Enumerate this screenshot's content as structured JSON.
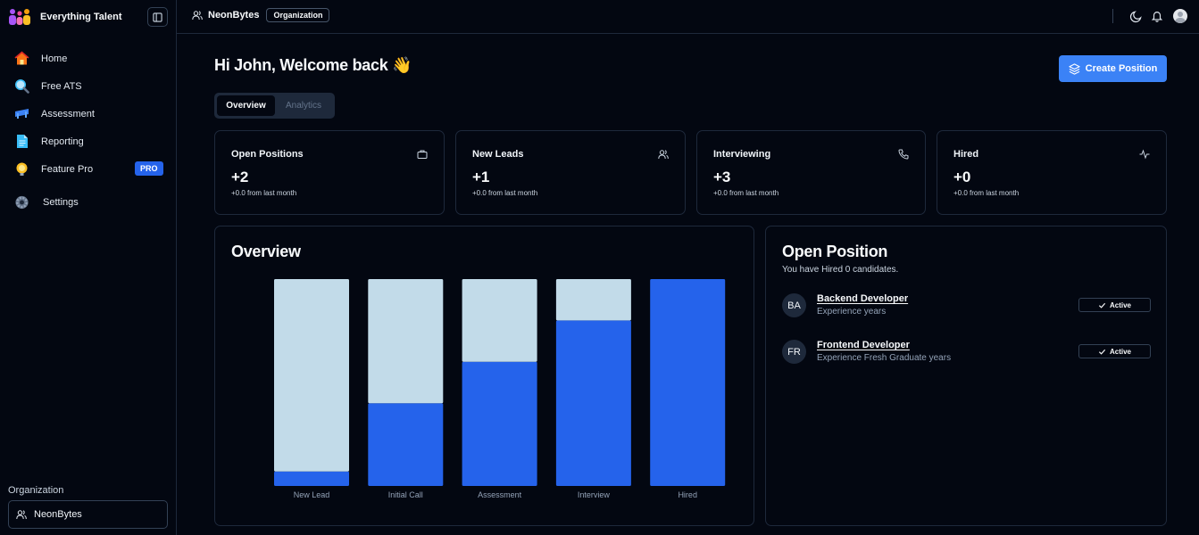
{
  "app": {
    "name": "Everything Talent"
  },
  "sidebar": {
    "items": [
      {
        "label": "Home",
        "icon": "home-icon"
      },
      {
        "label": "Free ATS",
        "icon": "magnifier-icon"
      },
      {
        "label": "Assessment",
        "icon": "assessment-icon"
      },
      {
        "label": "Reporting",
        "icon": "document-icon"
      },
      {
        "label": "Feature Pro",
        "icon": "lightbulb-icon",
        "badge": "PRO"
      },
      {
        "label": "Settings",
        "icon": "gear-icon"
      }
    ],
    "org_label": "Organization",
    "org_value": "NeonBytes"
  },
  "topbar": {
    "org_name": "NeonBytes",
    "org_badge": "Organization"
  },
  "main": {
    "greeting": "Hi John, Welcome back 👋",
    "create_label": "Create Position",
    "tabs": [
      {
        "label": "Overview",
        "active": true
      },
      {
        "label": "Analytics",
        "active": false
      }
    ]
  },
  "stats": [
    {
      "title": "Open Positions",
      "value": "+2",
      "sub": "+0.0 from last month",
      "icon": "briefcase-icon"
    },
    {
      "title": "New Leads",
      "value": "+1",
      "sub": "+0.0 from last month",
      "icon": "users-icon"
    },
    {
      "title": "Interviewing",
      "value": "+3",
      "sub": "+0.0 from last month",
      "icon": "phone-icon"
    },
    {
      "title": "Hired",
      "value": "+0",
      "sub": "+0.0 from last month",
      "icon": "activity-icon"
    }
  ],
  "overview": {
    "title": "Overview"
  },
  "chart_data": {
    "type": "bar",
    "stacked": true,
    "categories": [
      "New Lead",
      "Initial Call",
      "Assessment",
      "Interview",
      "Hired"
    ],
    "series": [
      {
        "color": "#2563eb",
        "values": [
          0.07,
          0.4,
          0.6,
          0.8,
          1.0
        ]
      },
      {
        "color": "#c2dbe9",
        "values": [
          0.93,
          0.6,
          0.4,
          0.2,
          0.0
        ]
      }
    ],
    "ylim": [
      0,
      1
    ],
    "grid": false
  },
  "open_position": {
    "title": "Open Position",
    "subtitle": "You have Hired 0 candidates.",
    "items": [
      {
        "initials": "BA",
        "name": "Backend Developer",
        "exp": "Experience years",
        "status": "Active"
      },
      {
        "initials": "FR",
        "name": "Frontend Developer",
        "exp": "Experience Fresh Graduate years",
        "status": "Active"
      }
    ]
  },
  "colors": {
    "accent": "#3b82f6",
    "bar_primary": "#2563eb",
    "bar_secondary": "#c2dbe9",
    "pro_badge": "#2563eb",
    "background": "#030711"
  }
}
